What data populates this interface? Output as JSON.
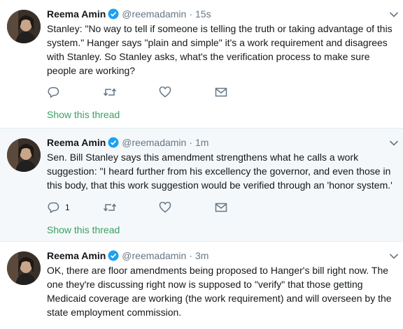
{
  "colors": {
    "link_green": "#38a163",
    "muted": "#657786",
    "verified_blue": "#1da1f2",
    "divider": "#e6ecf0",
    "highlight_bg": "#f5f8fa"
  },
  "icons": {
    "reply": "reply-icon",
    "retweet": "retweet-icon",
    "like": "heart-icon",
    "dm": "envelope-icon",
    "verified": "verified-badge-icon",
    "menu": "chevron-down-icon"
  },
  "tweets": [
    {
      "name": "Reema Amin",
      "handle": "@reemadamin",
      "separator": "·",
      "time": "15s",
      "text": "Stanley: \"No way to tell if someone is telling the truth or taking advantage of this system.\" Hanger says \"plain and simple\" it's a work requirement and disagrees with Stanley. So Stanley asks, what's the verification process to make sure people are working?",
      "reply_count": "",
      "show_thread": "Show this thread"
    },
    {
      "name": "Reema Amin",
      "handle": "@reemadamin",
      "separator": "·",
      "time": "1m",
      "text": "Sen. Bill Stanley says this amendment strengthens what he calls a work suggestion: \"I heard further from his excellency the governor, and even those in this body, that this work suggestion would be verified through an 'honor system.'",
      "reply_count": "1",
      "show_thread": "Show this thread"
    },
    {
      "name": "Reema Amin",
      "handle": "@reemadamin",
      "separator": "·",
      "time": "3m",
      "text": "OK, there are floor amendments being proposed to Hanger's bill right now. The one they're discussing right now is supposed to \"verify\" that those getting Medicaid coverage are working (the work requirement) and will overseen by the state employment commission.",
      "reply_count": "",
      "show_thread": ""
    }
  ]
}
